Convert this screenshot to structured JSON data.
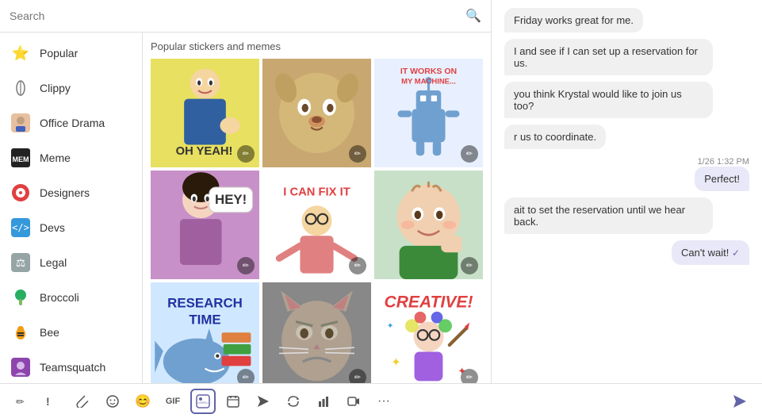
{
  "search": {
    "placeholder": "Search"
  },
  "sidebar": {
    "items": [
      {
        "id": "popular",
        "label": "Popular",
        "icon": "⭐",
        "color": "#f5c400"
      },
      {
        "id": "clippy",
        "label": "Clippy",
        "icon": "📎",
        "color": "#aaa"
      },
      {
        "id": "office-drama",
        "label": "Office Drama",
        "icon": "🎭",
        "color": "#c0392b"
      },
      {
        "id": "meme",
        "label": "Meme",
        "icon": "😂",
        "color": "#333"
      },
      {
        "id": "designers",
        "label": "Designers",
        "icon": "🎨",
        "color": "#e74c3c"
      },
      {
        "id": "devs",
        "label": "Devs",
        "icon": "💻",
        "color": "#3498db"
      },
      {
        "id": "legal",
        "label": "Legal",
        "icon": "⚖️",
        "color": "#555"
      },
      {
        "id": "broccoli",
        "label": "Broccoli",
        "icon": "🥦",
        "color": "#27ae60"
      },
      {
        "id": "bee",
        "label": "Bee",
        "icon": "🐝",
        "color": "#f39c12"
      },
      {
        "id": "teamsquatch",
        "label": "Teamsquatch",
        "icon": "👤",
        "color": "#8e44ad"
      }
    ]
  },
  "section_title": "Popular stickers and memes",
  "stickers": [
    {
      "id": "oh-yeah",
      "type": "oh-yeah",
      "text": "OH\nYEAH!"
    },
    {
      "id": "doge",
      "type": "doge",
      "text": ""
    },
    {
      "id": "it-works",
      "type": "it-works",
      "text": "IT WORKS ON\nMY MACHINE..."
    },
    {
      "id": "hey",
      "type": "hey",
      "text": "HEY!"
    },
    {
      "id": "i-can-fix",
      "type": "i-can-fix",
      "text": "I CAN FIX IT"
    },
    {
      "id": "baby",
      "type": "baby",
      "text": ""
    },
    {
      "id": "research",
      "type": "research",
      "text": "RESEARCH\nTIME"
    },
    {
      "id": "grumpy",
      "type": "grumpy",
      "text": ""
    },
    {
      "id": "creative",
      "type": "creative",
      "text": "CREATIVE!"
    }
  ],
  "chat": {
    "messages": [
      {
        "id": "m1",
        "type": "received",
        "text": "Friday works great for me."
      },
      {
        "id": "m2",
        "type": "received",
        "text": "I and see if I can set up a reservation for us."
      },
      {
        "id": "m3",
        "type": "received",
        "text": "you think Krystal would like to join us too?"
      },
      {
        "id": "m4",
        "type": "received",
        "text": "r us to coordinate."
      },
      {
        "id": "m5",
        "type": "sent",
        "time": "1/26 1:32 PM",
        "text": "Perfect!"
      },
      {
        "id": "m6",
        "type": "received",
        "text": "ait to set the reservation until we hear back."
      },
      {
        "id": "m7",
        "type": "sent",
        "text": "Can't wait!"
      }
    ]
  },
  "toolbar": {
    "icons": [
      {
        "id": "format",
        "symbol": "✏",
        "label": "format"
      },
      {
        "id": "exclaim",
        "symbol": "!",
        "label": "important"
      },
      {
        "id": "attach",
        "symbol": "📎",
        "label": "attach"
      },
      {
        "id": "emoji-panel",
        "symbol": "☺",
        "label": "emoji"
      },
      {
        "id": "emoji",
        "symbol": "😊",
        "label": "emoji-face"
      },
      {
        "id": "gif",
        "symbol": "GIF",
        "label": "gif"
      },
      {
        "id": "sticker",
        "symbol": "🗒",
        "label": "sticker",
        "active": true
      },
      {
        "id": "schedule",
        "symbol": "📅",
        "label": "schedule"
      },
      {
        "id": "send-plain",
        "symbol": "→",
        "label": "send-plain"
      },
      {
        "id": "loop",
        "symbol": "↺",
        "label": "loop"
      },
      {
        "id": "graph",
        "symbol": "📊",
        "label": "graph"
      },
      {
        "id": "video",
        "symbol": "▶",
        "label": "video"
      },
      {
        "id": "more",
        "symbol": "···",
        "label": "more"
      }
    ],
    "send_label": "Send"
  }
}
